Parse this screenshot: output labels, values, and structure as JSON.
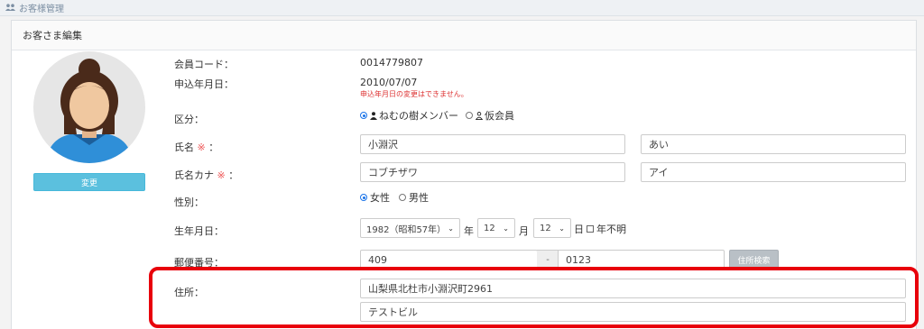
{
  "topbar": {
    "title": "お客様管理"
  },
  "panel": {
    "title": "お客さま編集"
  },
  "profile": {
    "change_label": "変更"
  },
  "fields": {
    "member_code": {
      "label": "会員コード：",
      "value": "0014779807"
    },
    "apply_date": {
      "label": "申込年月日：",
      "value": "2010/07/07",
      "warning": "申込年月日の変更はできません。"
    },
    "category": {
      "label": "区分：",
      "option1": "ねむの樹メンバー",
      "option2": "仮会員",
      "selected": "option1"
    },
    "name": {
      "label": "氏名",
      "req": "※",
      "suffix": "：",
      "last": "小淵沢",
      "first": "あい"
    },
    "name_kana": {
      "label": "氏名カナ",
      "req": "※",
      "suffix": "：",
      "last": "コブチザワ",
      "first": "アイ"
    },
    "gender": {
      "label": "性別：",
      "female": "女性",
      "male": "男性",
      "selected": "female"
    },
    "birth": {
      "label": "生年月日：",
      "year": "1982（昭和57年）",
      "year_unit": "年",
      "month": "12",
      "month_unit": "月",
      "day": "12",
      "day_unit": "日",
      "unknown": "年不明"
    },
    "postal": {
      "label": "郵便番号：",
      "part1": "409",
      "sep": "-",
      "part2": "0123",
      "search": "住所検索"
    },
    "address": {
      "label": "住所：",
      "line1": "山梨県北杜市小淵沢町2961",
      "line2": "テストビル"
    }
  },
  "colors": {
    "highlight": "#e8000b",
    "info_button": "#5bc0de",
    "radio_on": "#1a73e8"
  }
}
